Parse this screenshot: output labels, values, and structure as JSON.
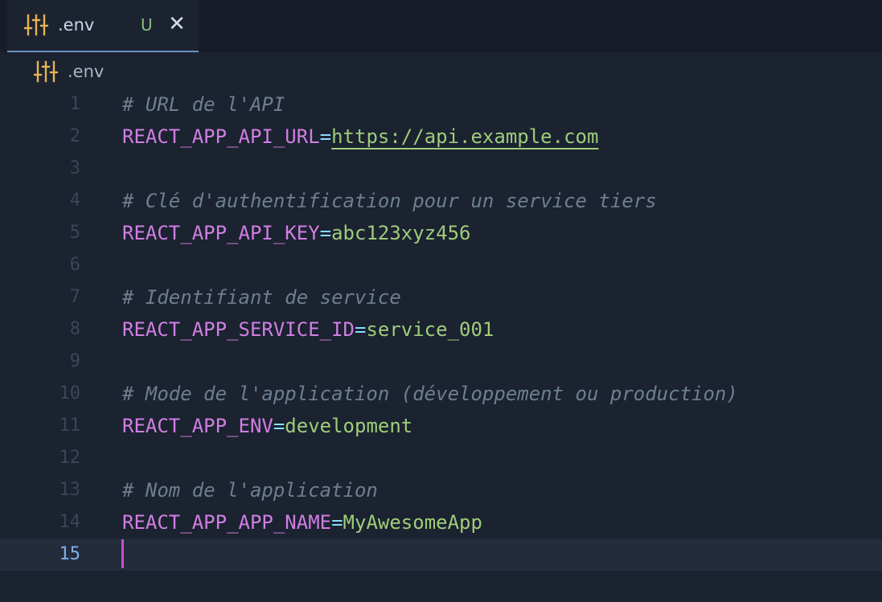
{
  "tab": {
    "icon": "settings-sliders-icon",
    "title": ".env",
    "status": "U",
    "close_glyph": "✕"
  },
  "breadcrumb": {
    "icon": "settings-sliders-icon",
    "label": ".env"
  },
  "colors": {
    "background": "#1b2230",
    "comment": "#6d7f91",
    "key": "#d07fe3",
    "value": "#9ecd7a",
    "icon": "#e6b450",
    "active_tab_border": "#6b8fc5",
    "untracked_badge": "#84c27a",
    "cursor": "#c34fd6"
  },
  "editor": {
    "current_line": 15,
    "lines": [
      {
        "n": "1",
        "comment": "# URL de l'API"
      },
      {
        "n": "2",
        "key": "REACT_APP_API_URL",
        "eq": "=",
        "value": "https://api.example.com",
        "link": true
      },
      {
        "n": "3"
      },
      {
        "n": "4",
        "comment": "# Clé d'authentification pour un service tiers"
      },
      {
        "n": "5",
        "key": "REACT_APP_API_KEY",
        "eq": "=",
        "value": "abc123xyz456"
      },
      {
        "n": "6"
      },
      {
        "n": "7",
        "comment": "# Identifiant de service"
      },
      {
        "n": "8",
        "key": "REACT_APP_SERVICE_ID",
        "eq": "=",
        "value": "service_001"
      },
      {
        "n": "9"
      },
      {
        "n": "10",
        "comment": "# Mode de l'application (développement ou production)"
      },
      {
        "n": "11",
        "key": "REACT_APP_ENV",
        "eq": "=",
        "value": "development"
      },
      {
        "n": "12"
      },
      {
        "n": "13",
        "comment": "# Nom de l'application"
      },
      {
        "n": "14",
        "key": "REACT_APP_APP_NAME",
        "eq": "=",
        "value": "MyAwesomeApp"
      },
      {
        "n": "15"
      }
    ]
  }
}
